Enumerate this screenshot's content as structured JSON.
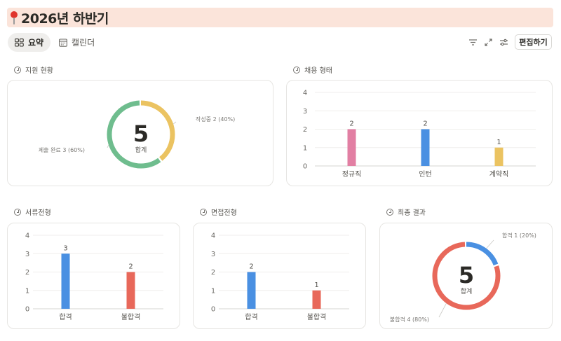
{
  "page": {
    "title": "2026년 하반기"
  },
  "tabs": [
    {
      "label": "요약",
      "icon": "grid-icon"
    },
    {
      "label": "캘린더",
      "icon": "calendar-icon"
    }
  ],
  "toolbar": {
    "edit_label": "편집하기"
  },
  "charts": {
    "application_status": {
      "label": "지원 현황",
      "center_value": "5",
      "center_label": "합계",
      "slices": [
        {
          "name": "작성중",
          "value": 2,
          "text": "작성중 2 (40%)",
          "color": "#ebc361"
        },
        {
          "name": "제출 완료",
          "value": 3,
          "text": "제출 완료 3 (60%)",
          "color": "#6fbd8e"
        }
      ]
    },
    "employment_type": {
      "label": "채용 형태",
      "yticks": [
        "0",
        "1",
        "2",
        "3",
        "4"
      ],
      "bars": [
        {
          "category": "정규직",
          "value": 2,
          "color": "#e27fa3"
        },
        {
          "category": "인턴",
          "value": 2,
          "color": "#4a90e2"
        },
        {
          "category": "계약직",
          "value": 1,
          "color": "#ebc361"
        }
      ]
    },
    "document_screening": {
      "label": "서류전형",
      "yticks": [
        "0",
        "1",
        "2",
        "3",
        "4"
      ],
      "bars": [
        {
          "category": "합격",
          "value": 3,
          "color": "#4a90e2"
        },
        {
          "category": "불합격",
          "value": 2,
          "color": "#e8685a"
        }
      ]
    },
    "interview_screening": {
      "label": "면접전형",
      "yticks": [
        "0",
        "1",
        "2",
        "3",
        "4"
      ],
      "bars": [
        {
          "category": "합격",
          "value": 2,
          "color": "#4a90e2"
        },
        {
          "category": "불합격",
          "value": 1,
          "color": "#e8685a"
        }
      ]
    },
    "final_result": {
      "label": "최종 결과",
      "center_value": "5",
      "center_label": "합계",
      "slices": [
        {
          "name": "합격",
          "value": 1,
          "text": "합격 1 (20%)",
          "color": "#4a90e2"
        },
        {
          "name": "불합격",
          "value": 4,
          "text": "불합격 4 (80%)",
          "color": "#e8685a"
        }
      ]
    }
  },
  "chart_data": [
    {
      "type": "pie",
      "categories": [
        "작성중",
        "제출 완료"
      ],
      "values": [
        2,
        3
      ]
    },
    {
      "type": "bar",
      "categories": [
        "정규직",
        "인턴",
        "계약직"
      ],
      "values": [
        2,
        2,
        1
      ],
      "ylim": [
        0,
        4
      ]
    },
    {
      "type": "bar",
      "categories": [
        "합격",
        "불합격"
      ],
      "values": [
        3,
        2
      ],
      "ylim": [
        0,
        4
      ]
    },
    {
      "type": "bar",
      "categories": [
        "합격",
        "불합격"
      ],
      "values": [
        2,
        1
      ],
      "ylim": [
        0,
        4
      ]
    },
    {
      "type": "pie",
      "categories": [
        "합격",
        "불합격"
      ],
      "values": [
        1,
        4
      ]
    }
  ]
}
